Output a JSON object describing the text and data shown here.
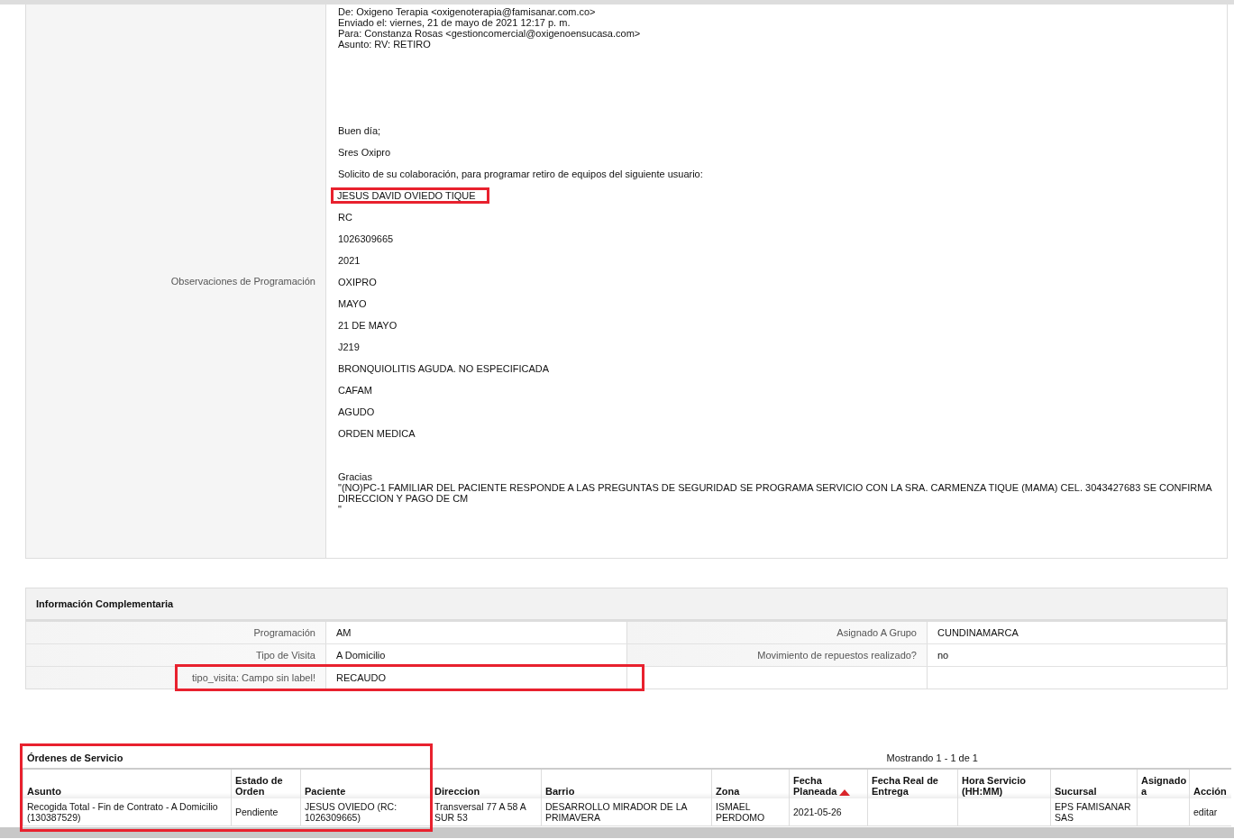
{
  "observations": {
    "label": "Observaciones de Programación",
    "blocks": [
      {
        "kind": "header",
        "lines": [
          {
            "text": "De: Oxigeno Terapia <oxigenoterapia@famisanar.com.co>",
            "highlighted": false
          },
          {
            "text": "Enviado el: viernes, 21 de mayo de 2021 12:17 p. m.",
            "highlighted": false
          },
          {
            "text": "Para: Constanza Rosas <gestioncomercial@oxigenoensucasa.com>",
            "highlighted": false
          },
          {
            "text": "Asunto: RV: RETIRO",
            "highlighted": false
          }
        ]
      },
      {
        "kind": "paragraph",
        "lines": [
          {
            "text": "Buen día;",
            "highlighted": false
          },
          {
            "text": "Sres Oxipro",
            "highlighted": false
          }
        ]
      },
      {
        "kind": "paragraph",
        "lines": [
          {
            "text": "Solicito de su colaboración, para programar retiro de equipos del siguiente usuario:",
            "highlighted": false
          }
        ]
      },
      {
        "kind": "paragraph",
        "lines": [
          {
            "text": "JESUS DAVID OVIEDO TIQUE",
            "highlighted": true
          },
          {
            "text": "RC",
            "highlighted": false
          },
          {
            "text": "1026309665",
            "highlighted": false
          },
          {
            "text": "2021",
            "highlighted": false
          },
          {
            "text": "OXIPRO",
            "highlighted": false
          },
          {
            "text": "MAYO",
            "highlighted": false
          },
          {
            "text": "21 DE MAYO",
            "highlighted": false
          },
          {
            "text": "J219",
            "highlighted": false
          },
          {
            "text": "BRONQUIOLITIS AGUDA. NO ESPECIFICADA",
            "highlighted": false
          },
          {
            "text": "CAFAM",
            "highlighted": false
          },
          {
            "text": "AGUDO",
            "highlighted": false
          },
          {
            "text": "ORDEN MEDICA",
            "highlighted": false
          }
        ]
      },
      {
        "kind": "signature",
        "lines": [
          {
            "text": "Gracias",
            "highlighted": false
          },
          {
            "text": "\"(NO)PC-1 FAMILIAR DEL PACIENTE RESPONDE A LAS PREGUNTAS DE SEGURIDAD SE PROGRAMA SERVICIO CON LA SRA. CARMENZA TIQUE (MAMA) CEL. 3043427683 SE CONFIRMA DIRECCION Y PAGO DE CM",
            "highlighted": false
          },
          {
            "text": "\"",
            "highlighted": false
          }
        ]
      }
    ]
  },
  "info": {
    "title": "Información Complementaria",
    "rows": [
      {
        "cells": [
          {
            "label": "Programación",
            "value": "AM"
          },
          {
            "label": "Asignado A Grupo",
            "value": "CUNDINAMARCA"
          }
        ],
        "highlighted": false
      },
      {
        "cells": [
          {
            "label": "Tipo de Visita",
            "value": "A Domicilio"
          },
          {
            "label": "Movimiento de repuestos realizado?",
            "value": "no"
          }
        ],
        "highlighted": false
      },
      {
        "cells": [
          {
            "label": "tipo_visita: Campo sin label!",
            "value": "RECAUDO"
          }
        ],
        "highlighted": true
      }
    ]
  },
  "orders": {
    "title": "Órdenes de Servicio",
    "highlighted": true,
    "pager": "Mostrando 1 - 1 de 1",
    "columns": [
      {
        "label": "Asunto",
        "sorted": false
      },
      {
        "label": "Estado de Orden",
        "sorted": false
      },
      {
        "label": "Paciente",
        "sorted": false
      },
      {
        "label": "Direccion",
        "sorted": false
      },
      {
        "label": "Barrio",
        "sorted": false
      },
      {
        "label": "Zona",
        "sorted": false
      },
      {
        "label": "Fecha Planeada",
        "sorted": true
      },
      {
        "label": "Fecha Real de Entrega",
        "sorted": false
      },
      {
        "label": "Hora Servicio (HH:MM)",
        "sorted": false
      },
      {
        "label": "Sucursal",
        "sorted": false
      },
      {
        "label": "Asignado a",
        "sorted": false
      },
      {
        "label": "Acción",
        "sorted": false
      }
    ],
    "rows": [
      {
        "cells": [
          "Recogida Total - Fin de Contrato - A Domicilio (130387529)",
          "Pendiente",
          "JESUS OVIEDO (RC: 1026309665)",
          "Transversal 77 A 58 A SUR 53",
          "DESARROLLO MIRADOR DE LA PRIMAVERA",
          "ISMAEL PERDOMO",
          "2021-05-26",
          "",
          "",
          "EPS FAMISANAR SAS",
          "",
          "editar"
        ]
      }
    ]
  }
}
